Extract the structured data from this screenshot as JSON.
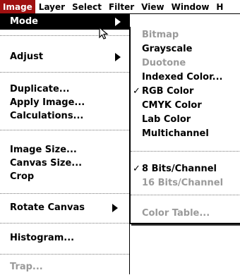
{
  "menubar": {
    "items": [
      "Image",
      "Layer",
      "Select",
      "Filter",
      "View",
      "Window",
      "H"
    ]
  },
  "image_menu": {
    "mode": "Mode",
    "adjust": "Adjust",
    "duplicate": "Duplicate...",
    "apply_image": "Apply Image...",
    "calculations": "Calculations...",
    "image_size": "Image Size...",
    "canvas_size": "Canvas Size...",
    "crop": "Crop",
    "rotate_canvas": "Rotate Canvas",
    "histogram": "Histogram...",
    "trap": "Trap..."
  },
  "mode_submenu": {
    "bitmap": "Bitmap",
    "grayscale": "Grayscale",
    "duotone": "Duotone",
    "indexed_color": "Indexed Color...",
    "rgb_color": "RGB Color",
    "cmyk_color": "CMYK Color",
    "lab_color": "Lab Color",
    "multichannel": "Multichannel",
    "bits8": "8 Bits/Channel",
    "bits16": "16 Bits/Channel",
    "color_table": "Color Table...",
    "check_glyph": "✓"
  },
  "colors": {
    "active_menu": "#9f1010",
    "highlight": "#000000",
    "disabled": "#9a9a9a"
  }
}
